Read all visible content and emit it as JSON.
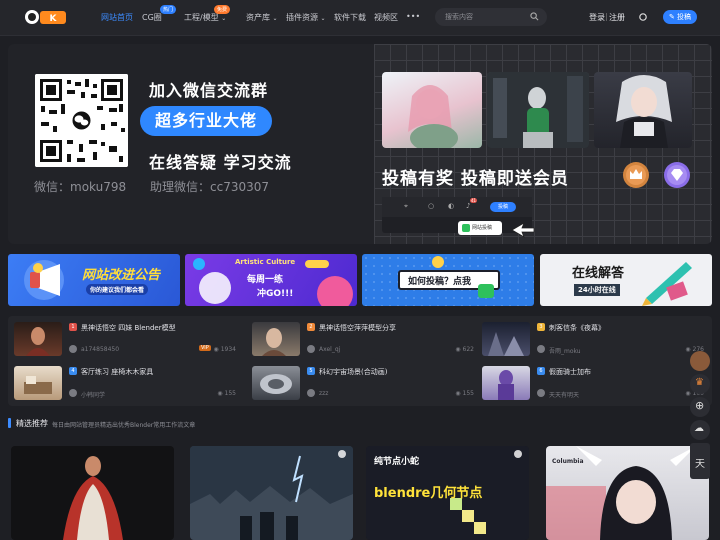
{
  "header": {
    "nav": [
      {
        "label": "网站首页",
        "active": true
      },
      {
        "label": "CG圈",
        "badge": "热门",
        "badge_color": "#2e80ff"
      },
      {
        "label": "工程/模型",
        "badge": "免费",
        "badge_color": "#ff7a2e"
      },
      {
        "label": "资产库"
      },
      {
        "label": "插件资源"
      },
      {
        "label": "软件下载"
      },
      {
        "label": "视频区"
      },
      {
        "label": "•••"
      }
    ],
    "search_placeholder": "搜索内容",
    "login": "登录",
    "register": "注册",
    "post_button": "投稿"
  },
  "banner": {
    "line1": "加入微信交流群",
    "pill": "超多行业大佬",
    "line2": "在线答疑 学习交流",
    "wechat": "微信：moku798",
    "assistant": "助理微信：cc730307",
    "right_text": "投稿有奖 投稿即送会员",
    "mini_badge": "41",
    "mini_post": "投稿",
    "mini_popup": "网站投稿"
  },
  "cards": [
    {
      "title": "网站改进公告",
      "sub": "你的建议我们都会看",
      "bg": "#2d6cf0"
    },
    {
      "title": "每周一练",
      "sub": "冲GO!!!",
      "tag": "Artistic Culture",
      "bg": "#6a34d9"
    },
    {
      "title": "如何投稿？点我",
      "bg": "#2e7de8"
    },
    {
      "title": "在线解答",
      "sub": "24小时在线",
      "bg": "#f0f1f4"
    }
  ],
  "list": [
    {
      "no": "1",
      "title": "黑神话悟空 四妹 Blender模型",
      "author": "a174858450",
      "vip": "ViP",
      "views": "1934",
      "color": "#e0524a"
    },
    {
      "no": "2",
      "title": "黑神话悟空萍萍模型分享",
      "author": "Axel_qj",
      "views": "622",
      "color": "#f08a3a"
    },
    {
      "no": "3",
      "title": "刺客信条《夜幕》",
      "author": "吾雨_moku",
      "views": "276",
      "color": "#f0b63a"
    },
    {
      "no": "4",
      "title": "客厅练习 座椅木木家具",
      "author": "小韩同学",
      "views": "155",
      "color": "#3a8cf0"
    },
    {
      "no": "5",
      "title": "科幻宇宙场景(合动画)",
      "author": "zzz",
      "views": "155",
      "color": "#3a8cf0"
    },
    {
      "no": "6",
      "title": "假面骑士加布",
      "author": "天天有明天",
      "views": "100",
      "color": "#3a8cf0"
    }
  ],
  "section": {
    "title": "精选推荐",
    "subtitle": "每日由网站管理员精选出优秀Blender常用工作流文章"
  },
  "gallery": [
    {
      "caption": ""
    },
    {
      "caption": ""
    },
    {
      "caption": "纯节点小蛇",
      "caption2": "blendre几何节点"
    },
    {
      "caption": "Columbia"
    }
  ],
  "sidebar": {
    "float_label": "天"
  }
}
